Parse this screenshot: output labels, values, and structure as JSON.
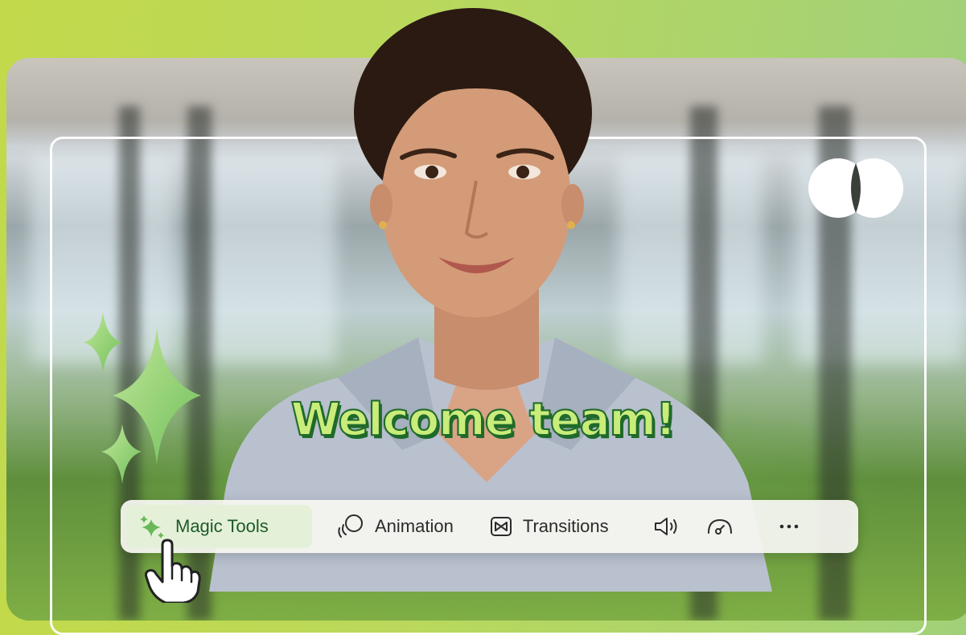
{
  "caption": {
    "text": "Welcome team!"
  },
  "toolbar": {
    "items": [
      {
        "label": "Magic Tools",
        "icon": "sparkle-icon",
        "active": true
      },
      {
        "label": "Animation",
        "icon": "animation-icon"
      },
      {
        "label": "Transitions",
        "icon": "transitions-icon"
      },
      {
        "label": "",
        "icon": "volume-icon"
      },
      {
        "label": "",
        "icon": "speed-gauge-icon"
      },
      {
        "label": "",
        "icon": "more-options-icon"
      }
    ]
  },
  "colors": {
    "background_gradient": [
      "#c2d94a",
      "#9ccf7e"
    ],
    "caption_fill": "#c9ec7a",
    "caption_outline": "#1f6a2a",
    "active_tab_bg": "#e4f1d8",
    "sparkle": "#8fcf6a"
  },
  "decorations": [
    "sparkles-icon",
    "logo-icon",
    "pointer-hand-icon"
  ]
}
